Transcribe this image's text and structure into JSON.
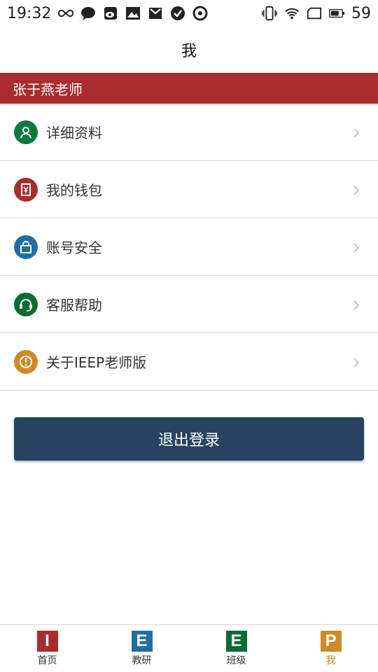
{
  "status_bar": {
    "time": "19:32",
    "battery": "59",
    "icons": [
      "infinity-icon",
      "chat-icon",
      "weibo-icon",
      "image-icon",
      "mail-icon",
      "check-icon",
      "sync-icon",
      "vibrate-icon",
      "wifi-icon",
      "sim-icon",
      "battery-icon"
    ]
  },
  "header": {
    "title": "我"
  },
  "user": {
    "name": "张于燕老师"
  },
  "menu": {
    "items": [
      {
        "label": "详细资料",
        "icon": "user-icon",
        "color": "#0d7a3e"
      },
      {
        "label": "我的钱包",
        "icon": "wallet-icon",
        "color": "#a92c2e"
      },
      {
        "label": "账号安全",
        "icon": "lock-icon",
        "color": "#1f6fa0"
      },
      {
        "label": "客服帮助",
        "icon": "headset-icon",
        "color": "#0d6b33"
      },
      {
        "label": "关于IEEP老师版",
        "icon": "info-icon",
        "color": "#d08a24"
      }
    ]
  },
  "logout": {
    "label": "退出登录",
    "color": "#264461"
  },
  "bottom_nav": {
    "items": [
      {
        "letter": "I",
        "label": "首页",
        "color": "#a92c2e"
      },
      {
        "letter": "E",
        "label": "教研",
        "color": "#1f6fa0"
      },
      {
        "letter": "E",
        "label": "班级",
        "color": "#0d6b33"
      },
      {
        "letter": "P",
        "label": "我",
        "color": "#d08a24"
      }
    ]
  }
}
